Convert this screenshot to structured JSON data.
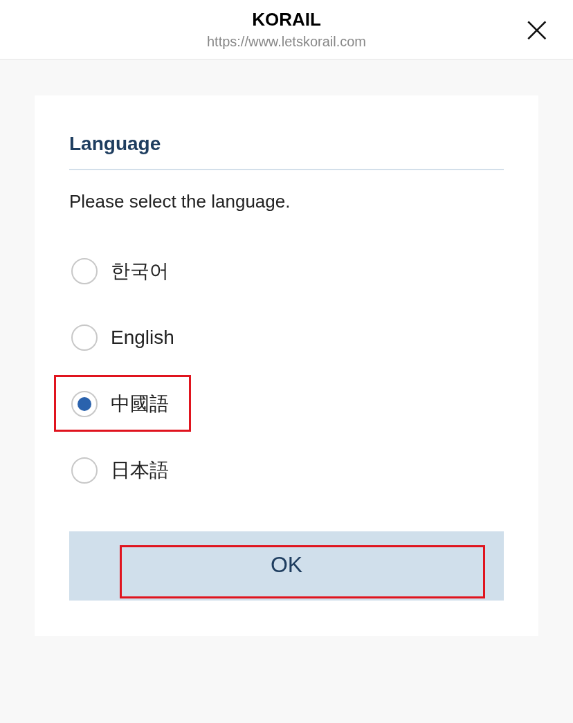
{
  "header": {
    "title": "KORAIL",
    "url": "https://www.letskorail.com",
    "close": "×"
  },
  "dialog": {
    "title": "Language",
    "prompt": "Please select the language.",
    "options": [
      {
        "label": "한국어",
        "selected": false,
        "highlighted": false
      },
      {
        "label": "English",
        "selected": false,
        "highlighted": false
      },
      {
        "label": "中國語",
        "selected": true,
        "highlighted": true
      },
      {
        "label": "日本語",
        "selected": false,
        "highlighted": false
      }
    ],
    "ok_button": {
      "label": "OK",
      "highlighted": true
    }
  }
}
